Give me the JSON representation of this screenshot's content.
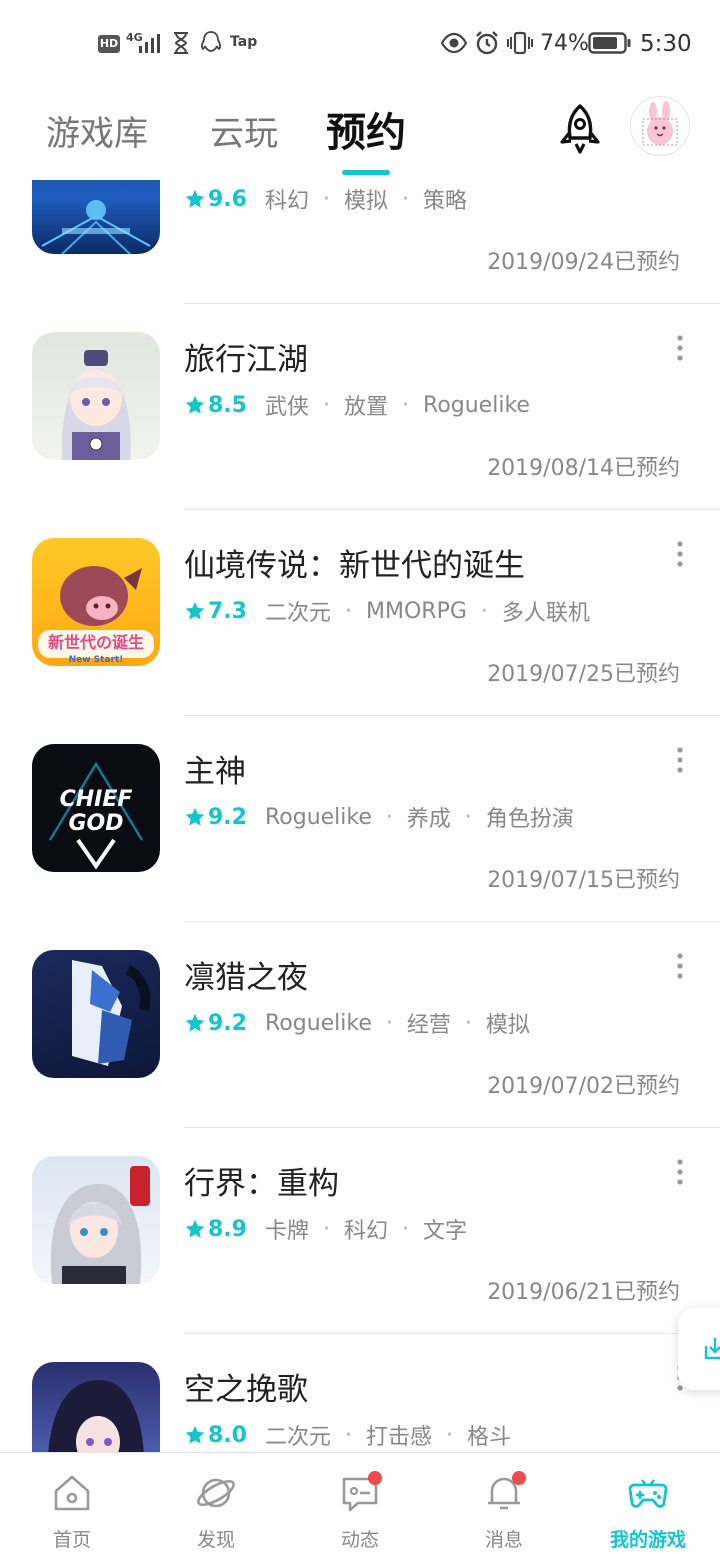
{
  "status_bar": {
    "hd": "HD",
    "network": "4G",
    "app_tag": "Tap",
    "battery_percent": "74%",
    "time": "5:30"
  },
  "tabs": {
    "games": "游戏库",
    "cloud": "云玩",
    "reserve": "预约"
  },
  "items": [
    {
      "title": "",
      "score": "9.6",
      "tags": [
        "科幻",
        "模拟",
        "策略"
      ],
      "date": "2019/09/24已预约"
    },
    {
      "title": "旅行江湖",
      "score": "8.5",
      "tags": [
        "武侠",
        "放置",
        "Roguelike"
      ],
      "date": "2019/08/14已预约"
    },
    {
      "title": "仙境传说：新世代的诞生",
      "score": "7.3",
      "tags": [
        "二次元",
        "MMORPG",
        "多人联机"
      ],
      "date": "2019/07/25已预约"
    },
    {
      "title": "主神",
      "score": "9.2",
      "tags": [
        "Roguelike",
        "养成",
        "角色扮演"
      ],
      "date": "2019/07/15已预约"
    },
    {
      "title": "凛猎之夜",
      "score": "9.2",
      "tags": [
        "Roguelike",
        "经营",
        "模拟"
      ],
      "date": "2019/07/02已预约"
    },
    {
      "title": "行界：重构",
      "score": "8.9",
      "tags": [
        "卡牌",
        "科幻",
        "文字"
      ],
      "date": "2019/06/21已预约"
    },
    {
      "title": "空之挽歌",
      "score": "8.0",
      "tags": [
        "二次元",
        "打击感",
        "格斗"
      ],
      "date": ""
    }
  ],
  "icon_art": {
    "chief_god_line1": "CHIEF",
    "chief_god_line2": "GOD",
    "ro_logo": "新世代の诞生",
    "ro_sub": "New Start!"
  },
  "nav": {
    "home": "首页",
    "discover": "发现",
    "feed": "动态",
    "messages": "消息",
    "my_games": "我的游戏"
  },
  "colors": {
    "accent": "#15c5ce",
    "badge": "#f04a4a"
  }
}
